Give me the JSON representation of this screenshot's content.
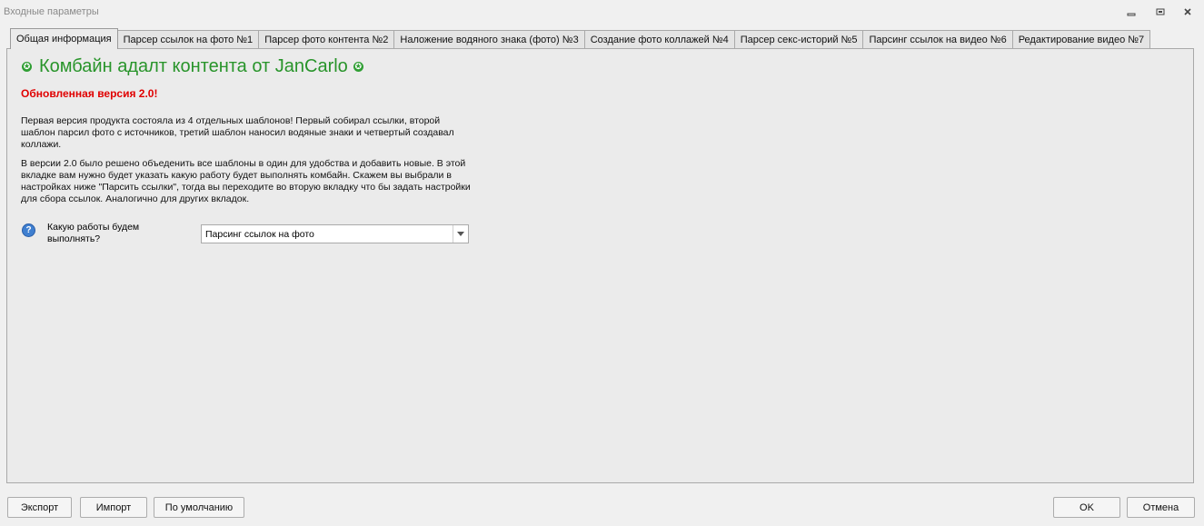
{
  "window": {
    "title": "Входные параметры"
  },
  "tabs": [
    {
      "label": "Общая информация",
      "active": true
    },
    {
      "label": "Парсер ссылок на фото №1",
      "active": false
    },
    {
      "label": "Парсер фото контента №2",
      "active": false
    },
    {
      "label": "Наложение водяного знака (фото) №3",
      "active": false
    },
    {
      "label": "Создание фото коллажей №4",
      "active": false
    },
    {
      "label": "Парсер секс-историй №5",
      "active": false
    },
    {
      "label": "Парсинг ссылок на видео №6",
      "active": false
    },
    {
      "label": "Редактирование видео №7",
      "active": false
    }
  ],
  "content": {
    "heading": "Комбайн адалт контента от JanCarlo",
    "subtitle": "Обновленная версия 2.0!",
    "paragraph1": "Первая версия продукта состояла из 4 отдельных шаблонов! Первый собирал ссылки, второй шаблон парсил фото с источников, третий шаблон наносил водяные знаки и четвертый создавал коллажи.",
    "paragraph2": "В версии 2.0 было решено объеденить все шаблоны в один для удобства и добавить новые. В этой вкладке вам нужно будет указать какую работу будет выполнять комбайн. Скажем вы выбрали в настройках ниже \"Парсить ссылки\", тогда вы переходите во вторую вкладку что бы задать настройки для сбора ссылок. Аналогично для других вкладок.",
    "question_label": "Какую работы будем выполнять?",
    "select_value": "Парсинг ссылок на фото"
  },
  "footer": {
    "export": "Экспорт",
    "import": "Импорт",
    "default": "По умолчанию",
    "ok": "OK",
    "cancel": "Отмена"
  },
  "colors": {
    "heading": "#28942a",
    "subtitle": "#e00000",
    "help_icon": "#3f7fd0"
  }
}
